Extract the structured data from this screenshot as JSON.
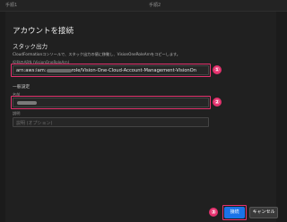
{
  "steps": {
    "step1": "手順1",
    "step2": "手順2"
  },
  "dialog": {
    "title": "アカウントを接続",
    "section_title": "スタック出力",
    "description": "CloudFormationコンソールで、スタック出力の値に移動し、VisionOneRoleArnをコピーします。",
    "arn_label": "役割のARN (VisionOneRoleArn)",
    "arn_value_prefix": "arn:aws:iam:",
    "arn_value_suffix": "role/Vision-One-Cloud-Account-Management-VisionOn",
    "general_title": "一般設定",
    "name_label": "名前",
    "description_label": "説明",
    "description_placeholder": "説明 (オプション)"
  },
  "buttons": {
    "connect": "接続",
    "cancel": "キャンセル"
  },
  "markers": {
    "m1": "①",
    "m2": "②",
    "m3": "③"
  },
  "colors": {
    "highlight": "#e4326e",
    "primary_button": "#1a73e8"
  }
}
